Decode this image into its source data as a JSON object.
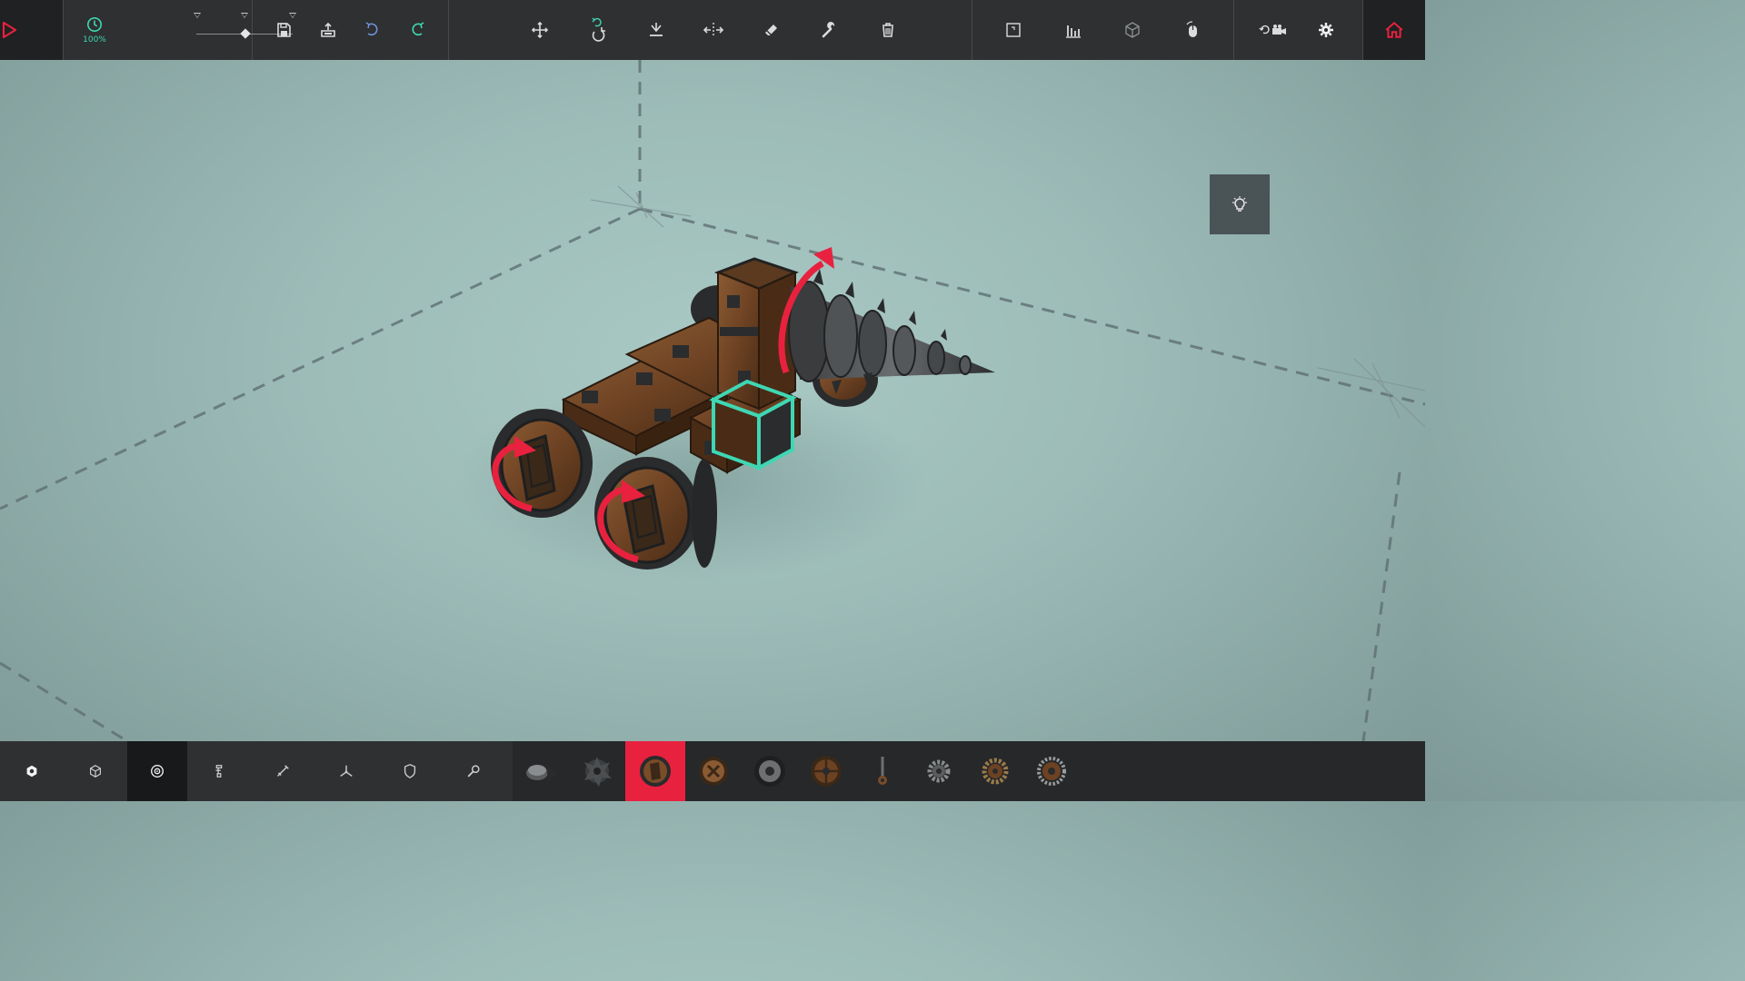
{
  "colors": {
    "accent_red": "#e8213f",
    "accent_teal": "#3fd7b3",
    "bar_bg": "#2e3031",
    "icon_light": "#dcdcdc"
  },
  "topbar": {
    "play_icon": "play-icon",
    "speed": {
      "icon": "clock-icon",
      "label": "100%",
      "slider_value": 0.5
    },
    "file_icons": [
      "save-icon",
      "load-icon",
      "undo-icon",
      "redo-icon"
    ],
    "tool_icons": [
      "translate-icon",
      "rotate-icon",
      "snap-down-icon",
      "mirror-icon",
      "eraser-icon",
      "wrench-icon",
      "trash-icon"
    ],
    "view_icons": [
      "keymap-icon",
      "stats-icon",
      "block-outline-icon",
      "mouse-orbit-icon"
    ],
    "camera_icons": [
      "camera-reset-icon",
      "settings-gear-icon"
    ],
    "home_icon": "home-icon"
  },
  "hint": {
    "icon": "lightbulb-icon"
  },
  "bottombar": {
    "category_icons": [
      "basic-block-icon",
      "cube-icon",
      "locomotion-gear-icon",
      "mechanical-icon",
      "weapons-icon",
      "flight-icon",
      "armour-shield-icon",
      "utility-wrench-icon"
    ],
    "active_category": 2,
    "blocks": [
      "spinning-block",
      "drill-block",
      "wheel-block",
      "large-wheel-block",
      "unpowered-wheel-block",
      "powered-wheel-block",
      "steering-hinge-block",
      "cog-small-block",
      "cog-medium-block",
      "cog-large-block"
    ],
    "selected_block": 2
  }
}
